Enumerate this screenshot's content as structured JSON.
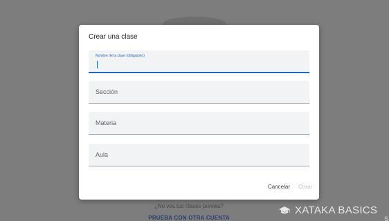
{
  "dialog": {
    "title": "Crear una clase",
    "fields": [
      {
        "label": "Nombre de la clase (obligatorio)",
        "value": ""
      },
      {
        "label": "Sección",
        "value": ""
      },
      {
        "label": "Materia",
        "value": ""
      },
      {
        "label": "Aula",
        "value": ""
      }
    ],
    "cancel_label": "Cancelar",
    "create_label": "Crear"
  },
  "background": {
    "question": "¿No ves tus clases previas?",
    "link": "PRUEBA CON OTRA CUENTA"
  },
  "watermark": {
    "icon": "graduation-cap-icon",
    "text": "XATAKA BASICS",
    "edge_char": "S"
  },
  "colors": {
    "overlay": "#7d7d7d",
    "accent": "#1967d2",
    "field_fill": "#f1f3f4",
    "disabled": "#bdc1c6"
  }
}
